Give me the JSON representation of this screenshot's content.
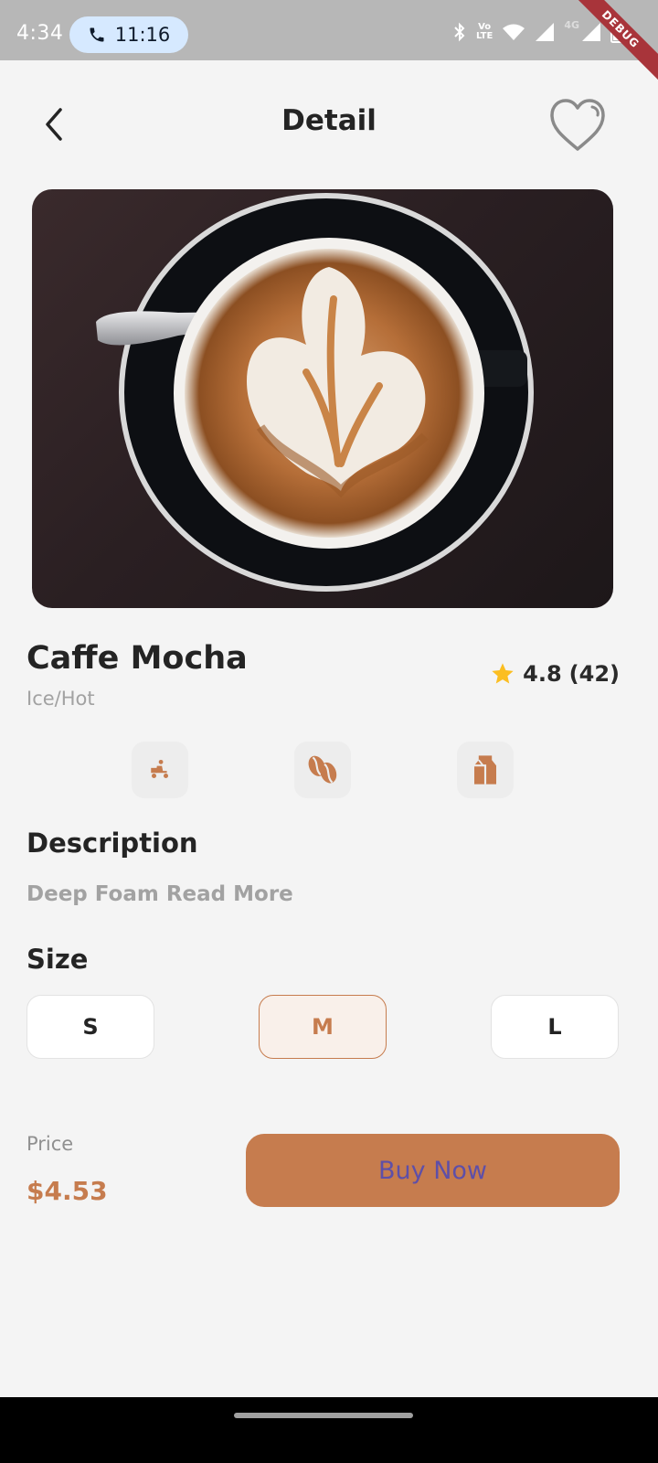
{
  "status_bar": {
    "time": "4:34",
    "call_time": "11:16",
    "volte_line1": "Vo",
    "volte_line2": "LTE",
    "network": "4G",
    "debug_label": "DEBUG"
  },
  "header": {
    "title": "Detail",
    "back_icon": "chevron-left-icon",
    "favorite_icon": "heart-outline-icon"
  },
  "product": {
    "name": "Caffe Mocha",
    "variant": "Ice/Hot",
    "rating": "4.8",
    "reviews": "(42)",
    "image_desc": "latte-art-cup"
  },
  "features": [
    {
      "icon": "delivery-scooter-icon"
    },
    {
      "icon": "coffee-bean-icon"
    },
    {
      "icon": "milk-carton-icon"
    }
  ],
  "description": {
    "heading": "Description",
    "text": "Deep Foam Read More"
  },
  "size": {
    "heading": "Size",
    "options": [
      "S",
      "M",
      "L"
    ],
    "selected": "M"
  },
  "purchase": {
    "price_label": "Price",
    "price": "$4.53",
    "buy_label": "Buy Now"
  },
  "colors": {
    "accent": "#c67c4e",
    "accent_light": "#f9f0ea",
    "background": "#f4f4f4",
    "star": "#fbbe21"
  }
}
